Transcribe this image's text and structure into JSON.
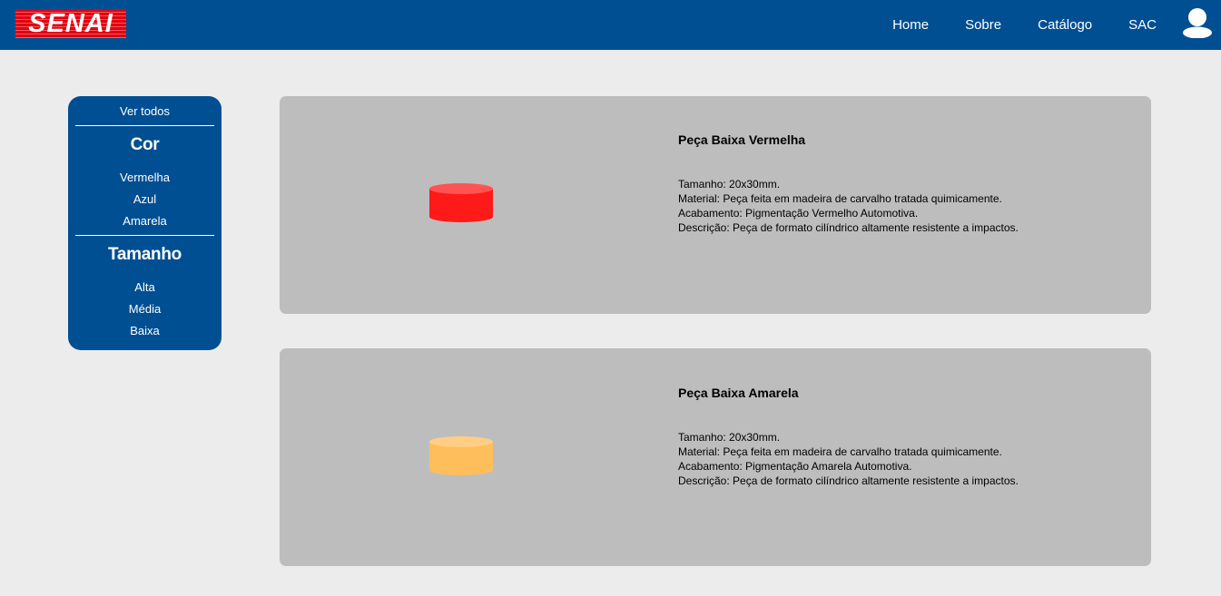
{
  "header": {
    "logo_text": "SENAI",
    "brand_color": "#004f93",
    "logo_color": "#e3000f",
    "nav": [
      {
        "label": "Home"
      },
      {
        "label": "Sobre"
      },
      {
        "label": "Catálogo"
      },
      {
        "label": "SAC"
      }
    ],
    "user_icon": "user-icon"
  },
  "sidebar": {
    "view_all": "Ver todos",
    "color_heading": "Cor",
    "colors": [
      "Vermelha",
      "Azul",
      "Amarela"
    ],
    "size_heading": "Tamanho",
    "sizes": [
      "Alta",
      "Média",
      "Baixa"
    ]
  },
  "products": [
    {
      "title": "Peça Baixa Vermelha",
      "image_color": "#ff1a1a",
      "details": [
        "Tamanho: 20x30mm.",
        "Material: Peça feita em madeira de carvalho tratada quimicamente.",
        "Acabamento: Pigmentação Vermelho Automotiva.",
        "Descrição: Peça de formato cilíndrico altamente resistente a impactos."
      ]
    },
    {
      "title": "Peça Baixa Amarela",
      "image_color": "#ffbe5c",
      "details": [
        "Tamanho: 20x30mm.",
        "Material: Peça feita em madeira de carvalho tratada quimicamente.",
        "Acabamento: Pigmentação Amarela Automotiva.",
        "Descrição: Peça de formato cilíndrico altamente resistente a impactos."
      ]
    }
  ]
}
